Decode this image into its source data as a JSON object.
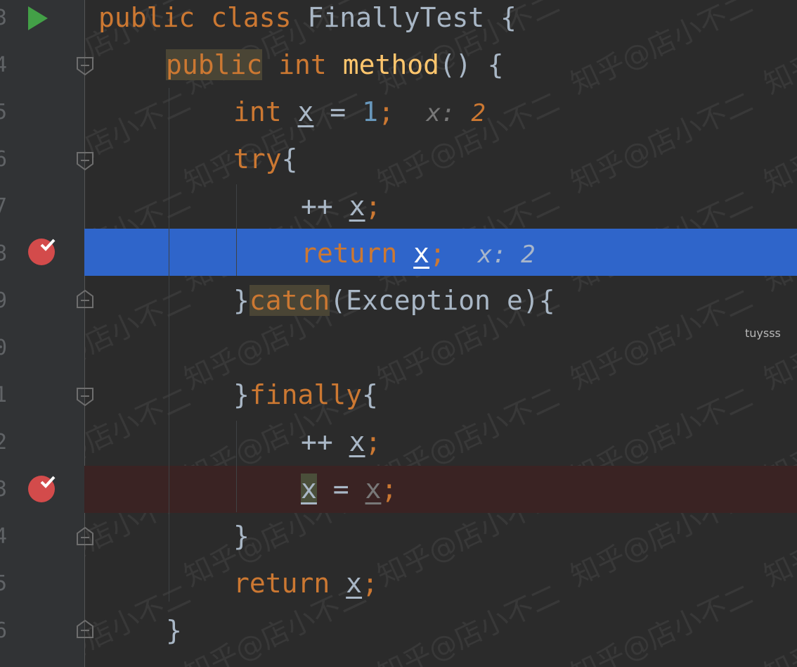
{
  "editor": {
    "line_numbers": [
      "3",
      "4",
      "5",
      "6",
      "7",
      "8",
      "9",
      "0",
      "1",
      "2",
      "3",
      "4",
      "5",
      "6"
    ],
    "code": {
      "l1": {
        "kw1": "public",
        "kw2": "class",
        "name": "FinallyTest",
        "brace": "{"
      },
      "l2": {
        "kw1": "public",
        "kw2": "int",
        "name": "method",
        "rest": "() {"
      },
      "l3": {
        "kw": "int",
        "var": "x",
        "op": " = ",
        "num": "1",
        "semi": ";",
        "hint_label": "x:",
        "hint_value": "2"
      },
      "l4": {
        "kw": "try",
        "brace": "{"
      },
      "l5": {
        "op": "++ ",
        "var": "x",
        "semi": ";"
      },
      "l6": {
        "kw": "return",
        "var": "x",
        "semi": ";",
        "hint": "x: 2"
      },
      "l7": {
        "brace": "}",
        "kw": "catch",
        "rest": "(Exception e){"
      },
      "l9": {
        "brace": "}",
        "kw": "finally",
        "brace2": "{"
      },
      "l10": {
        "op": "++ ",
        "var": "x",
        "semi": ";"
      },
      "l11": {
        "var1": "x",
        "op": " = ",
        "var2": "x",
        "semi": ";"
      },
      "l12": {
        "brace": "}"
      },
      "l13": {
        "kw": "return",
        "var": "x",
        "semi": ";"
      },
      "l14": {
        "brace": "}"
      }
    }
  },
  "overlay_label": "tuysss",
  "watermark_text": "知乎@店小不二",
  "colors": {
    "background": "#2b2b2b",
    "gutter": "#313335",
    "keyword": "#cc7832",
    "function": "#ffc66d",
    "number": "#6897bb",
    "text": "#a9b7c6",
    "current_line": "#2f65ca",
    "breakpoint_line": "#3a2323",
    "breakpoint": "#d34b4b",
    "run": "#43a047"
  },
  "icons": [
    "run-icon",
    "breakpoint-icon",
    "fold-icon"
  ]
}
